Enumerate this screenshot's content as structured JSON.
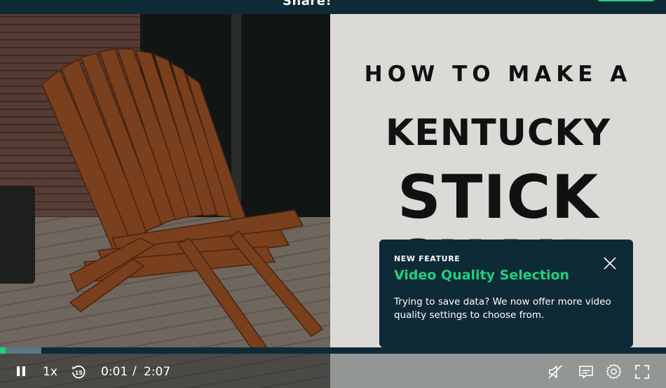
{
  "header": {
    "title": "Share!",
    "cta_color": "#1fd17a"
  },
  "video": {
    "overlay_text": {
      "line1": "HOW TO MAKE A",
      "line2": "KENTUCKY",
      "line3": "STICK",
      "line4": "CHAIR"
    }
  },
  "popup": {
    "eyebrow": "NEW FEATURE",
    "title": "Video Quality Selection",
    "body": "Trying to save data? We now offer more video quality settings to choose from.",
    "close_icon": "close-icon"
  },
  "player": {
    "played_fraction": 0.008,
    "buffered_fraction": 0.062,
    "speed_label": "1x",
    "current_time": "0:01",
    "separator": "/",
    "duration": "2:07",
    "icons": [
      "pause-icon",
      "rewind-15-icon",
      "mute-icon",
      "captions-icon",
      "settings-gear-icon",
      "fullscreen-icon"
    ],
    "accent_color": "#1fd17a"
  }
}
